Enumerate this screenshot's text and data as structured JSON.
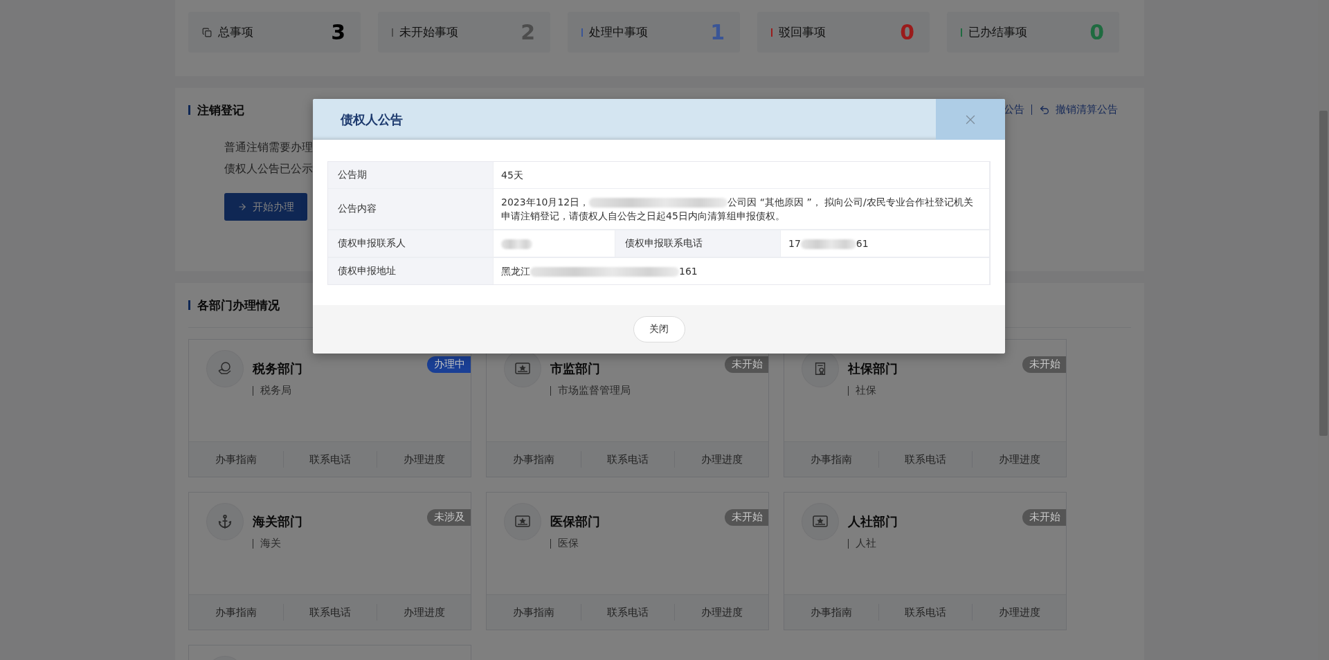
{
  "stats": [
    {
      "label": "总事项",
      "value": "3",
      "kind": "total"
    },
    {
      "label": "未开始事项",
      "value": "2",
      "kind": "bar",
      "color": "#4d4d4d"
    },
    {
      "label": "处理中事项",
      "value": "1",
      "kind": "bar",
      "color": "#3a5596"
    },
    {
      "label": "驳回事项",
      "value": "0",
      "kind": "bar",
      "color": "#9a1b1b"
    },
    {
      "label": "已办结事项",
      "value": "0",
      "kind": "bar",
      "color": "#1f6b40"
    }
  ],
  "cancellation": {
    "title": "注销登记",
    "lines": [
      "普通注销需要办理",
      "债权人公告已公示"
    ],
    "start_button": "开始办理",
    "links": [
      {
        "label": "公告",
        "kind": "plain"
      },
      {
        "label": "撤销清算公告",
        "kind": "undo"
      }
    ]
  },
  "departments": {
    "title": "各部门办理情况",
    "cards": [
      {
        "kind": "tax",
        "name": "税务部门",
        "office": "税务局",
        "status": "办理中",
        "color": "#1a3f95",
        "actions": [
          "办事指南",
          "联系电话",
          "办理进度"
        ]
      },
      {
        "kind": "card",
        "name": "市监部门",
        "office": "市场监督管理局",
        "status": "未开始",
        "color": "#555555",
        "actions": [
          "办事指南",
          "联系电话",
          "办理进度"
        ]
      },
      {
        "kind": "doc",
        "name": "社保部门",
        "office": "社保",
        "status": "未开始",
        "color": "#555555",
        "actions": [
          "办事指南",
          "联系电话",
          "办理进度"
        ]
      },
      {
        "kind": "anchor",
        "name": "海关部门",
        "office": "海关",
        "status": "未涉及",
        "color": "#555555",
        "actions": [
          "办事指南",
          "联系电话",
          "办理进度"
        ]
      },
      {
        "kind": "card",
        "name": "医保部门",
        "office": "医保",
        "status": "未开始",
        "color": "#555555",
        "actions": [
          "办事指南",
          "联系电话",
          "办理进度"
        ]
      },
      {
        "kind": "card",
        "name": "人社部门",
        "office": "人社",
        "status": "未开始",
        "color": "#555555",
        "actions": [
          "办事指南",
          "联系电话",
          "办理进度"
        ]
      },
      {
        "kind": "partial"
      }
    ]
  },
  "dialog": {
    "title": "债权人公告",
    "rows": [
      {
        "kind": "single",
        "label": "公告期",
        "value": [
          {
            "kind": "text",
            "text": "45天"
          }
        ]
      },
      {
        "kind": "single",
        "label": "公告内容",
        "value": [
          {
            "kind": "text",
            "text": "2023年10月12日，"
          },
          {
            "kind": "blur"
          },
          {
            "kind": "text",
            "text": "公司因 “其他原因 ”， 拟向公司/农民专业合作社登记机关申请注销登记，请债权人自公告之日起45日内向清算组申报债权。"
          }
        ]
      },
      {
        "kind": "double",
        "label": "债权申报联系人",
        "value": [
          {
            "kind": "blur"
          }
        ],
        "label2": "债权申报联系电话",
        "value2": [
          {
            "kind": "text",
            "text": "17"
          },
          {
            "kind": "blur"
          },
          {
            "kind": "text",
            "text": "61"
          }
        ]
      },
      {
        "kind": "single",
        "label": "债权申报地址",
        "value": [
          {
            "kind": "text",
            "text": "黑龙江"
          },
          {
            "kind": "blur"
          },
          {
            "kind": "text",
            "text": "161"
          }
        ]
      }
    ],
    "close_button": "关闭"
  }
}
